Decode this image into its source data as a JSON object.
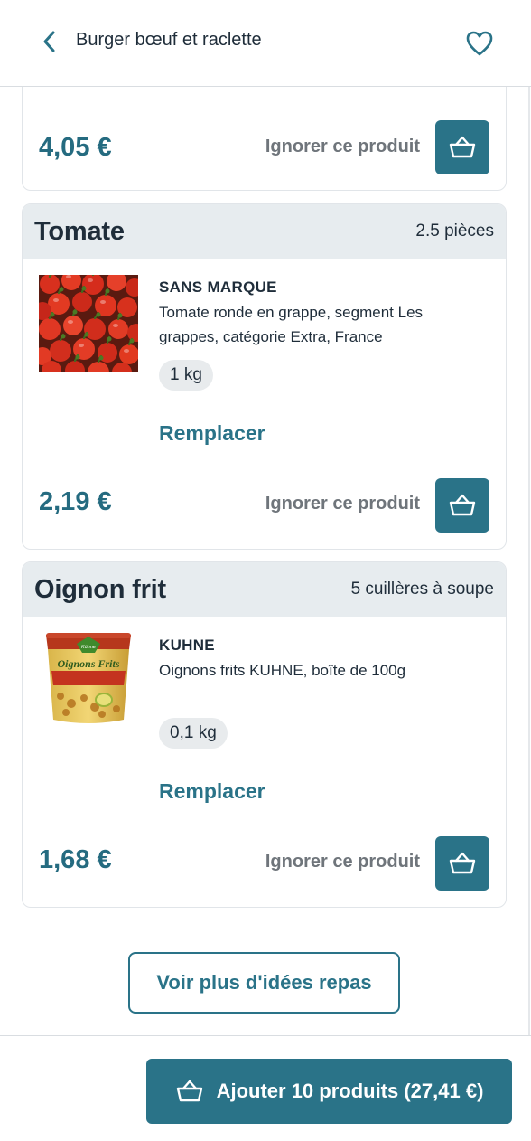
{
  "header": {
    "title": "Burger bœuf et raclette",
    "back_icon": "chevron-left-icon",
    "favorite_icon": "heart-icon"
  },
  "cards": [
    {
      "price": "4,05 €",
      "ignore_label": "Ignorer ce produit",
      "cart_icon": "basket-icon"
    },
    {
      "ingredient": "Tomate",
      "quantity": "2.5 pièces",
      "brand": "SANS MARQUE",
      "description": "Tomate ronde en grappe, segment Les grappes, catégorie Extra, France",
      "weight": "1 kg",
      "replace_label": "Remplacer",
      "price": "2,19 €",
      "ignore_label": "Ignorer ce produit",
      "cart_icon": "basket-icon"
    },
    {
      "ingredient": "Oignon frit",
      "quantity": "5 cuillères à soupe",
      "brand": "KUHNE",
      "description": "Oignons frits KUHNE, boîte de 100g",
      "weight": "0,1 kg",
      "replace_label": "Remplacer",
      "price": "1,68 €",
      "ignore_label": "Ignorer ce produit",
      "cart_icon": "basket-icon",
      "image_text": {
        "brand_logo": "Kühne",
        "product": "Oignons Frits"
      }
    }
  ],
  "more_ideas_label": "Voir plus d'idées repas",
  "footer": {
    "add_label": "Ajouter 10 produits (27,41 €)",
    "icon": "basket-icon"
  },
  "colors": {
    "accent": "#2a7388",
    "price": "#256b80",
    "card_header_bg": "#e7ecef",
    "text": "#1f2d3a"
  }
}
